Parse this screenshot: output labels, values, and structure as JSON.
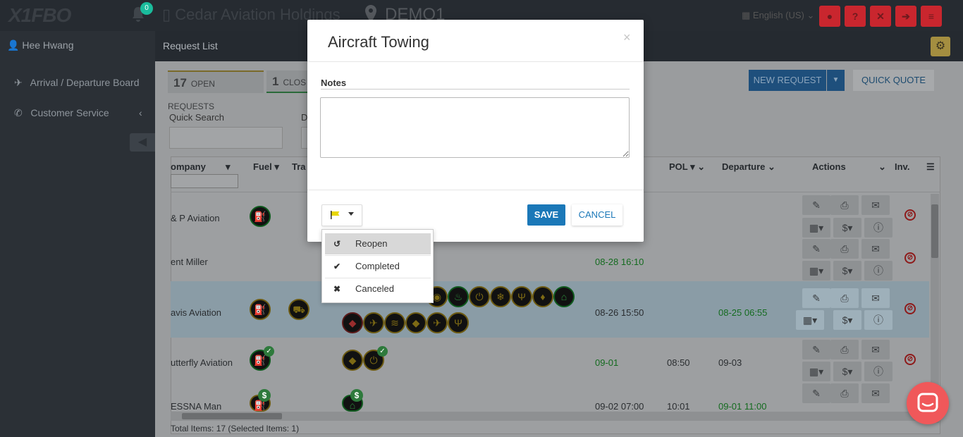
{
  "header": {
    "logo": "X1FBO",
    "notification_count": "0",
    "company": "Cedar Aviation Holdings",
    "station": "DEMO1",
    "language": "English (US)",
    "language_caret": "⌄"
  },
  "sidebar": {
    "user": "Hee Hwang",
    "items": [
      {
        "label": "Arrival / Departure Board",
        "icon": "plane-icon"
      },
      {
        "label": "Customer Service",
        "icon": "phone-icon"
      }
    ],
    "collapse_caret": "‹"
  },
  "page": {
    "title": "Request List",
    "tabs": [
      {
        "count": "17",
        "label": "OPEN REQUESTS"
      },
      {
        "count": "1",
        "label": "CLOS"
      }
    ],
    "new_request": "NEW REQUEST",
    "quick_quote": "QUICK QUOTE",
    "quick_search_label": "Quick Search",
    "d_label": "D",
    "total": "Total Items: 17 (Selected Items: 1)"
  },
  "grid": {
    "columns": [
      "ompany",
      "Fuel",
      "Tra",
      "POL",
      "Departure",
      "Actions",
      "Inv."
    ],
    "rows": [
      {
        "company": "& P Aviation",
        "arrival": "",
        "pol": "",
        "departure": ""
      },
      {
        "company": "ent Miller",
        "arrival": "08-28 16:10",
        "pol": "",
        "departure": ""
      },
      {
        "company": "avis Aviation",
        "arrival": "08-26 15:50",
        "pol": "",
        "departure": "08-25 06:55"
      },
      {
        "company": "utterfly Aviation",
        "arrival": "09-01",
        "pol": "08:50",
        "departure": "09-03"
      },
      {
        "company": "ESSNA Man",
        "arrival": "09-02 07:00",
        "pol": "10:01",
        "departure": "09-01 11:00"
      }
    ]
  },
  "modal": {
    "title": "Aircraft Towing",
    "close": "×",
    "notes_label": "Notes",
    "notes_value": "",
    "save": "SAVE",
    "cancel": "CANCEL",
    "flag_color": "#e8d600",
    "status_menu": [
      {
        "label": "Reopen",
        "icon": "undo-icon",
        "glyph": "↺"
      },
      {
        "label": "Completed",
        "icon": "check-circle-icon",
        "glyph": "✔"
      },
      {
        "label": "Canceled",
        "icon": "x-circle-icon",
        "glyph": "✖"
      }
    ]
  },
  "colors": {
    "primary": "#1b78b8",
    "danger": "#c9262e",
    "chat": "#f0585a"
  }
}
